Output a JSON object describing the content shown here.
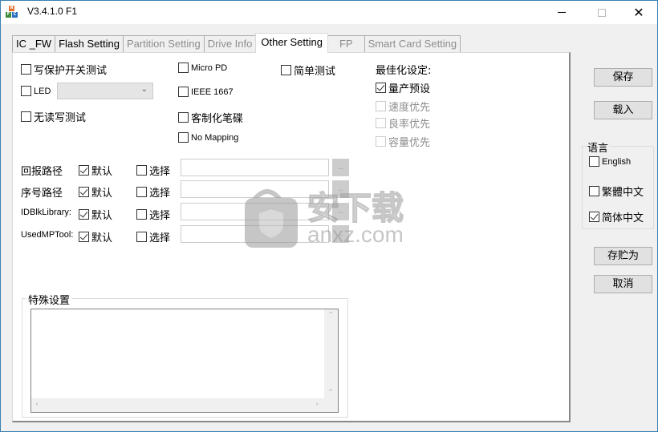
{
  "window": {
    "title": "V3.4.1.0 F1",
    "controls": {
      "minimize": "—",
      "maximize": "☐",
      "close": "✕"
    }
  },
  "tabs": [
    {
      "label": "IC _FW",
      "state": "normal"
    },
    {
      "label": "Flash Setting",
      "state": "normal"
    },
    {
      "label": "Partition Setting",
      "state": "disabled"
    },
    {
      "label": "Drive Info",
      "state": "disabled"
    },
    {
      "label": "Other Setting",
      "state": "active"
    },
    {
      "label": "FP",
      "state": "disabled"
    },
    {
      "label": "Smart Card Setting",
      "state": "disabled"
    }
  ],
  "options": {
    "write_protect_test": {
      "label": "写保护开关测试",
      "checked": false
    },
    "led": {
      "label": "LED",
      "checked": false,
      "combo_value": ""
    },
    "no_rw_test": {
      "label": "无读写测试",
      "checked": false
    },
    "micro_pd": {
      "label": "Micro PD",
      "checked": false
    },
    "ieee_1667": {
      "label": "IEEE 1667",
      "checked": false
    },
    "custom_disk": {
      "label": "客制化笔碟",
      "checked": false
    },
    "no_mapping": {
      "label": "No Mapping",
      "checked": false
    },
    "simple_test": {
      "label": "简单测试",
      "checked": false
    }
  },
  "optimize": {
    "title": "最佳化设定:",
    "items": [
      {
        "label": "量产预设",
        "checked": true,
        "disabled": false
      },
      {
        "label": "速度优先",
        "checked": false,
        "disabled": true
      },
      {
        "label": "良率优先",
        "checked": false,
        "disabled": true
      },
      {
        "label": "容量优先",
        "checked": false,
        "disabled": true
      }
    ]
  },
  "paths": [
    {
      "label": "回报路径",
      "default_label": "默认",
      "default_checked": true,
      "select_label": "选择",
      "select_checked": false,
      "value": "",
      "browse": ".."
    },
    {
      "label": "序号路径",
      "default_label": "默认",
      "default_checked": true,
      "select_label": "选择",
      "select_checked": false,
      "value": "",
      "browse": ".."
    },
    {
      "label": "IDBlkLibrary:",
      "default_label": "默认",
      "default_checked": true,
      "select_label": "选择",
      "select_checked": false,
      "value": "",
      "browse": ".."
    },
    {
      "label": "UsedMPTool:",
      "default_label": "默认",
      "default_checked": true,
      "select_label": "选择",
      "select_checked": false,
      "value": "",
      "browse": ".."
    }
  ],
  "special": {
    "title": "特殊设置",
    "value": ""
  },
  "side": {
    "save": "保存",
    "load": "载入",
    "save_as": "存贮为",
    "cancel": "取消",
    "language": {
      "title": "语言",
      "items": [
        {
          "label": "English",
          "checked": false
        },
        {
          "label": "繁體中文",
          "checked": false
        },
        {
          "label": "简体中文",
          "checked": true
        }
      ]
    }
  },
  "watermark": {
    "cn": "安下载",
    "en": "anxz.com"
  }
}
